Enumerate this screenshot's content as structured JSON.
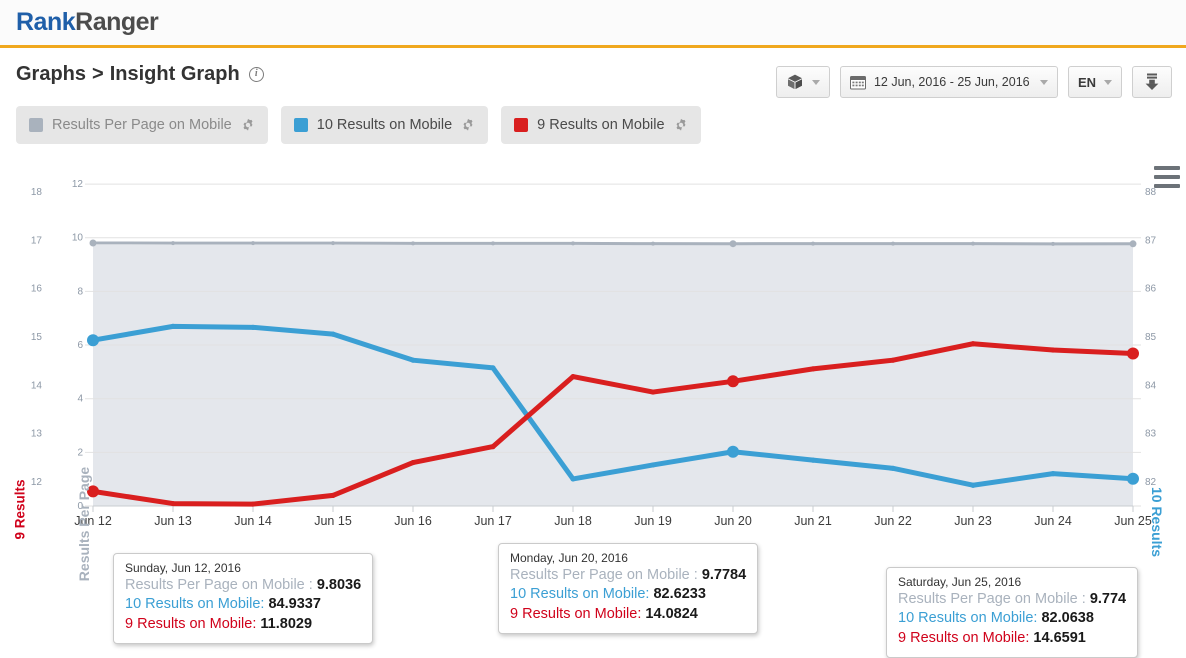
{
  "brand": {
    "part1": "Rank",
    "part2": "Ranger"
  },
  "header": {
    "breadcrumb_root": "Graphs",
    "separator": ">",
    "breadcrumb_current": "Insight Graph",
    "info_glyph": "i"
  },
  "toolbar": {
    "cube_label": "",
    "date_range": "12 Jun, 2016 - 25 Jun, 2016",
    "language": "EN",
    "download_label": ""
  },
  "legend": [
    {
      "label": "Results Per Page on Mobile",
      "color": "#a9b2bd",
      "active": false
    },
    {
      "label": "10 Results on Mobile",
      "color": "#3b9fd4",
      "active": true
    },
    {
      "label": "9 Results on Mobile",
      "color": "#d91f1f",
      "active": true
    }
  ],
  "axes": {
    "left_title": "9 Results",
    "left_ticks": [
      "18",
      "17",
      "16",
      "15",
      "14",
      "13",
      "12"
    ],
    "left_color": "#d0021b",
    "mid_title": "Results Per Page",
    "mid_ticks": [
      "12",
      "10",
      "8",
      "6",
      "4",
      "2",
      "0"
    ],
    "mid_color": "#a9b2bd",
    "right_title": "10 Results",
    "right_ticks": [
      "88",
      "87",
      "86",
      "85",
      "84",
      "83",
      "82"
    ],
    "right_color": "#3b9fd4"
  },
  "tooltips": [
    {
      "date": "Sunday, Jun 12, 2016",
      "rows": [
        {
          "label": "Results Per Page on Mobile :",
          "value": "9.8036"
        },
        {
          "label": "10 Results on Mobile:",
          "value": "84.9337"
        },
        {
          "label": "9 Results on Mobile:",
          "value": "11.8029"
        }
      ]
    },
    {
      "date": "Monday, Jun 20, 2016",
      "rows": [
        {
          "label": "Results Per Page on Mobile :",
          "value": "9.7784"
        },
        {
          "label": "10 Results on Mobile:",
          "value": "82.6233"
        },
        {
          "label": "9 Results on Mobile:",
          "value": "14.0824"
        }
      ]
    },
    {
      "date": "Saturday, Jun 25, 2016",
      "rows": [
        {
          "label": "Results Per Page on Mobile :",
          "value": "9.774"
        },
        {
          "label": "10 Results on Mobile:",
          "value": "82.0638"
        },
        {
          "label": "9 Results on Mobile:",
          "value": "14.6591"
        }
      ]
    }
  ],
  "chart_data": {
    "type": "line",
    "title": "Insight Graph",
    "xlabel": "",
    "grid": true,
    "legend_position": "top",
    "categories": [
      "Jun 12",
      "Jun 13",
      "Jun 14",
      "Jun 15",
      "Jun 16",
      "Jun 17",
      "Jun 18",
      "Jun 19",
      "Jun 20",
      "Jun 21",
      "Jun 22",
      "Jun 23",
      "Jun 24",
      "Jun 25"
    ],
    "axes": {
      "left": {
        "label": "9 Results",
        "ticks": [
          18,
          17,
          16,
          15,
          14,
          13,
          12
        ],
        "ylim": [
          11.5,
          18.5
        ],
        "color": "#d0021b"
      },
      "mid": {
        "label": "Results Per Page",
        "ticks": [
          12,
          10,
          8,
          6,
          4,
          2,
          0
        ],
        "ylim": [
          0,
          12.6
        ],
        "color": "#a9b2bd"
      },
      "right": {
        "label": "10 Results",
        "ticks": [
          88,
          87,
          86,
          85,
          84,
          83,
          82
        ],
        "ylim": [
          81.5,
          88.5
        ],
        "color": "#3b9fd4"
      }
    },
    "series": [
      {
        "name": "Results Per Page on Mobile",
        "color": "#a9b2bd",
        "axis": "mid",
        "values": [
          9.8036,
          9.8,
          9.8,
          9.8,
          9.79,
          9.79,
          9.79,
          9.78,
          9.7784,
          9.78,
          9.78,
          9.78,
          9.77,
          9.774
        ]
      },
      {
        "name": "10 Results on Mobile",
        "color": "#3b9fd4",
        "axis": "right",
        "values": [
          84.9337,
          85.22,
          85.2,
          85.06,
          84.52,
          84.36,
          82.06,
          82.35,
          82.6233,
          82.45,
          82.28,
          81.93,
          82.17,
          82.0638
        ]
      },
      {
        "name": "9 Results on Mobile",
        "color": "#d91f1f",
        "axis": "left",
        "values": [
          11.8029,
          11.55,
          11.54,
          11.72,
          12.4,
          12.73,
          14.18,
          13.86,
          14.0824,
          14.34,
          14.52,
          14.86,
          14.73,
          14.6591
        ]
      }
    ]
  }
}
